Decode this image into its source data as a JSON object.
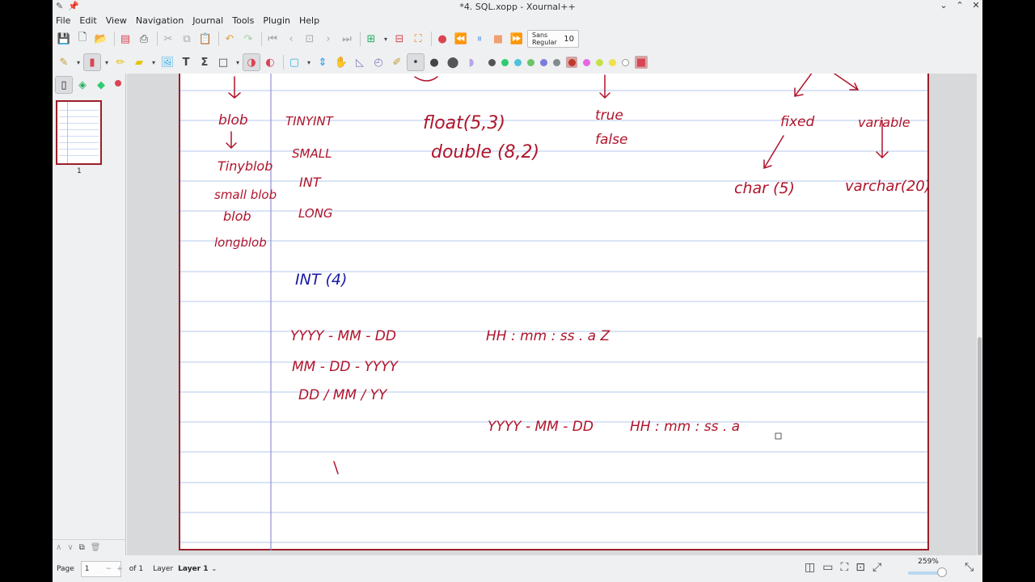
{
  "window": {
    "title": "*4. SQL.xopp - Xournal++",
    "controls": [
      "⌄",
      "⌃",
      "✕"
    ]
  },
  "menu": [
    "File",
    "Edit",
    "View",
    "Navigation",
    "Journal",
    "Tools",
    "Plugin",
    "Help"
  ],
  "font": {
    "name": "Sans Regular",
    "size": "10"
  },
  "toolbar_colors": {
    "pen_accent": "#da4453",
    "palette": [
      "#555555",
      "#2ecc71",
      "#4cc3d9",
      "#6ac46a",
      "#7c7cdc",
      "#7f8c8d",
      "#d35d6e",
      "#e667e6",
      "#c5e04b",
      "#f1e04b",
      "#ffffff",
      "#d35d6e"
    ]
  },
  "sidebar": {
    "page_number": "1"
  },
  "status": {
    "page_label": "Page",
    "page_value": "1",
    "of_label": "of 1",
    "layer_label": "Layer",
    "layer_value": "Layer 1",
    "zoom": "259%"
  },
  "notes": {
    "c1_top": "blob",
    "c1_l2": "Tinyblob",
    "c1_l3": "small blob",
    "c1_l4": "blob",
    "c1_l5": "longblob",
    "c2_l1": "TINYINT",
    "c2_l2": "SMALL",
    "c2_l3": "INT",
    "c2_l4": "LONG",
    "c2_l5": "INT (4)",
    "c3_l1": "float(5,3)",
    "c3_l2": "double (8,2)",
    "c4_l1": "true",
    "c4_l2": "false",
    "c5_l1": "fixed",
    "c5_l2": "char (5)",
    "c6_l1": "variable",
    "c6_l2": "varchar(20)",
    "d1": "YYYY - MM - DD",
    "d2": "MM - DD - YYYY",
    "d3": "DD / MM / YY",
    "t1": "HH : mm : ss . a  Z",
    "d4": "YYYY - MM - DD",
    "t2": "HH : mm : ss . a"
  }
}
